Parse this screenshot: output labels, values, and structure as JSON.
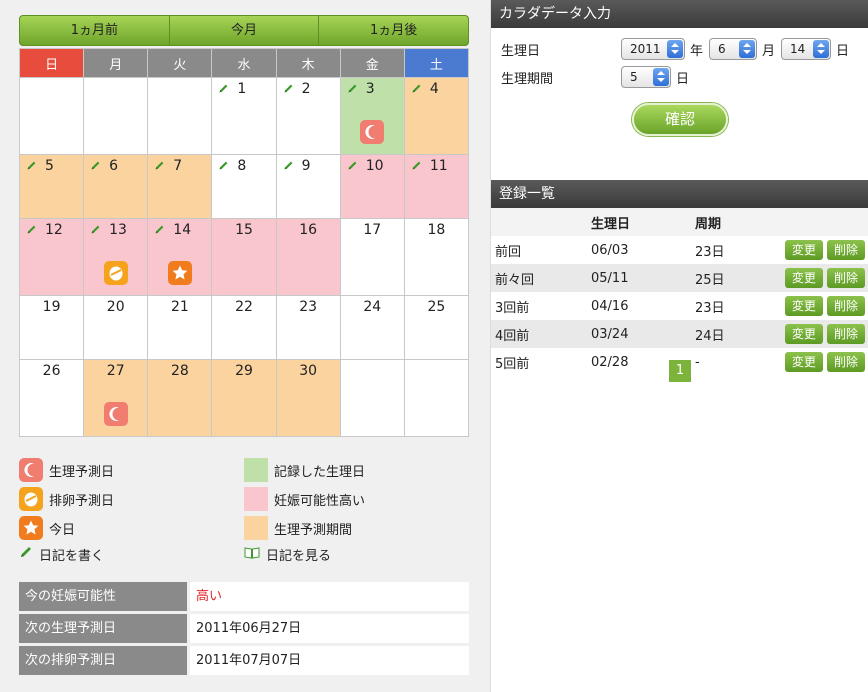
{
  "nav": {
    "prev": "1ヵ月前",
    "current": "今月",
    "next": "1ヵ月後"
  },
  "weekdays": [
    "日",
    "月",
    "火",
    "水",
    "木",
    "金",
    "土"
  ],
  "calendar": [
    [
      {
        "d": ""
      },
      {
        "d": ""
      },
      {
        "d": ""
      },
      {
        "d": "1",
        "pen": true
      },
      {
        "d": "2",
        "pen": true
      },
      {
        "d": "3",
        "pen": true,
        "bg": "green",
        "icon": "moon"
      },
      {
        "d": "4",
        "pen": true,
        "bg": "orange"
      }
    ],
    [
      {
        "d": "5",
        "pen": true,
        "bg": "orange"
      },
      {
        "d": "6",
        "pen": true,
        "bg": "orange"
      },
      {
        "d": "7",
        "pen": true,
        "bg": "orange"
      },
      {
        "d": "8",
        "pen": true
      },
      {
        "d": "9",
        "pen": true
      },
      {
        "d": "10",
        "pen": true,
        "bg": "pink"
      },
      {
        "d": "11",
        "pen": true,
        "bg": "pink"
      }
    ],
    [
      {
        "d": "12",
        "pen": true,
        "bg": "pink"
      },
      {
        "d": "13",
        "pen": true,
        "bg": "pink",
        "icon": "egg"
      },
      {
        "d": "14",
        "pen": true,
        "bg": "pink",
        "icon": "star"
      },
      {
        "d": "15",
        "bg": "pink"
      },
      {
        "d": "16",
        "bg": "pink"
      },
      {
        "d": "17"
      },
      {
        "d": "18"
      }
    ],
    [
      {
        "d": "19"
      },
      {
        "d": "20"
      },
      {
        "d": "21"
      },
      {
        "d": "22"
      },
      {
        "d": "23"
      },
      {
        "d": "24"
      },
      {
        "d": "25"
      }
    ],
    [
      {
        "d": "26"
      },
      {
        "d": "27",
        "bg": "orange",
        "icon": "moon"
      },
      {
        "d": "28",
        "bg": "orange"
      },
      {
        "d": "29",
        "bg": "orange"
      },
      {
        "d": "30",
        "bg": "orange"
      },
      {
        "d": ""
      },
      {
        "d": ""
      }
    ]
  ],
  "legend": {
    "period_forecast": "生理予測日",
    "recorded_period": "記録した生理日",
    "ovulation_forecast": "排卵予測日",
    "high_fertility": "妊娠可能性高い",
    "today": "今日",
    "period_forecast_range": "生理予測期間",
    "write_diary": "日記を書く",
    "view_diary": "日記を見る"
  },
  "info": {
    "fertility_label": "今の妊娠可能性",
    "fertility_value": "高い",
    "next_period_label": "次の生理予測日",
    "next_period_value": "2011年06月27日",
    "next_ovulation_label": "次の排卵予測日",
    "next_ovulation_value": "2011年07月07日"
  },
  "form": {
    "title": "カラダデータ入力",
    "start_label": "生理日",
    "year": "2011",
    "year_unit": "年",
    "month": "6",
    "month_unit": "月",
    "day": "14",
    "day_unit": "日",
    "period_label": "生理期間",
    "period_days": "5",
    "period_unit": "日",
    "confirm": "確認"
  },
  "records": {
    "title": "登録一覧",
    "headers": {
      "date": "生理日",
      "cycle": "周期"
    },
    "edit_label": "変更",
    "delete_label": "削除",
    "rows": [
      {
        "name": "前回",
        "date": "06/03",
        "cycle": "23日"
      },
      {
        "name": "前々回",
        "date": "05/11",
        "cycle": "25日"
      },
      {
        "name": "3回前",
        "date": "04/16",
        "cycle": "23日"
      },
      {
        "name": "4回前",
        "date": "03/24",
        "cycle": "24日"
      },
      {
        "name": "5回前",
        "date": "02/28",
        "cycle": "-"
      }
    ],
    "page": "1"
  },
  "colors": {
    "green": "#bfe0a8",
    "pink": "#f8c6cc",
    "orange": "#fbd39e",
    "accent": "#7cb33a"
  },
  "icons": {
    "moon": "moon-icon",
    "egg": "egg-icon",
    "star": "star-icon",
    "pen": "pencil-icon",
    "book": "book-icon"
  }
}
